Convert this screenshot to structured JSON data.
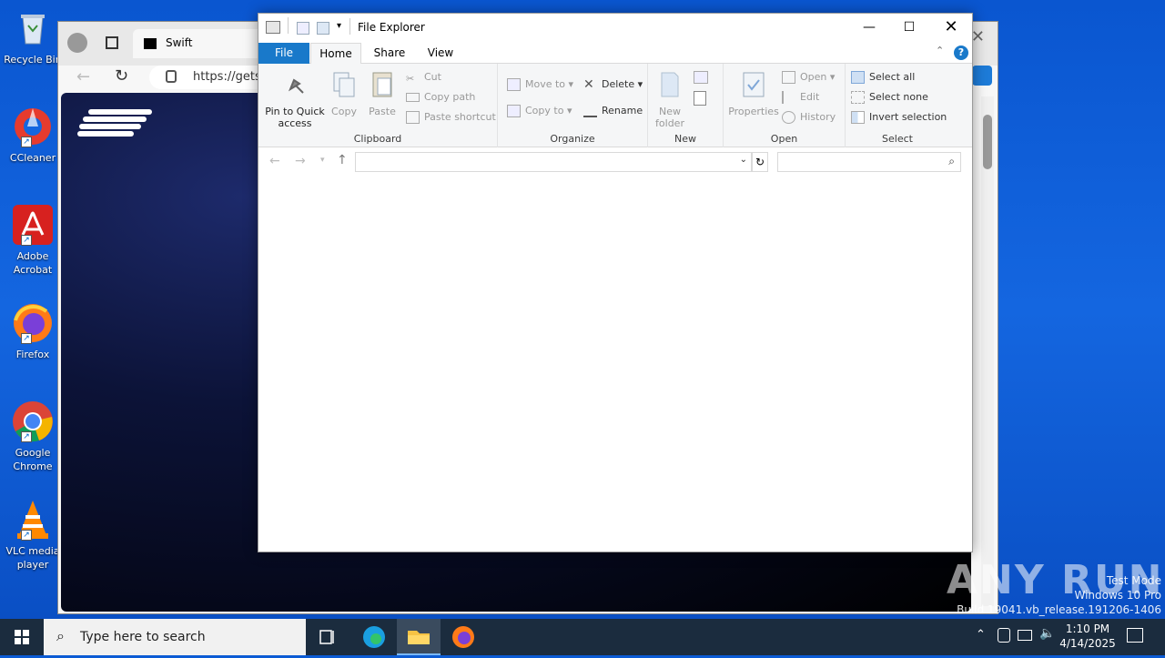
{
  "desktop": {
    "icons": [
      {
        "label": "Recycle Bin",
        "icon": "recycle-bin-icon"
      },
      {
        "label": "CCleaner",
        "icon": "ccleaner-icon"
      },
      {
        "label": "Adobe Acrobat",
        "icon": "adobe-acrobat-icon"
      },
      {
        "label": "Firefox",
        "icon": "firefox-icon"
      },
      {
        "label": "Google Chrome",
        "icon": "chrome-icon"
      },
      {
        "label": "VLC media player",
        "icon": "vlc-icon"
      }
    ]
  },
  "browser": {
    "tab_title": "Swift",
    "url": "https://gets"
  },
  "explorer": {
    "title": "File Explorer",
    "tabs": {
      "file": "File",
      "home": "Home",
      "share": "Share",
      "view": "View"
    },
    "clipboard": {
      "pin": "Pin to Quick access",
      "copy": "Copy",
      "paste": "Paste",
      "cut": "Cut",
      "copy_path": "Copy path",
      "paste_shortcut": "Paste shortcut",
      "label": "Clipboard"
    },
    "organize": {
      "move_to": "Move to",
      "copy_to": "Copy to",
      "delete": "Delete",
      "rename": "Rename",
      "label": "Organize"
    },
    "new": {
      "new_folder": "New folder",
      "label": "New"
    },
    "open": {
      "properties": "Properties",
      "open": "Open",
      "edit": "Edit",
      "history": "History",
      "label": "Open"
    },
    "select": {
      "select_all": "Select all",
      "select_none": "Select none",
      "invert": "Invert selection",
      "label": "Select"
    }
  },
  "taskbar": {
    "search_placeholder": "Type here to search",
    "time": "1:10 PM",
    "date": "4/14/2025"
  },
  "watermark": {
    "brand": "ANY RUN",
    "line1": "Test Mode",
    "line2": "Windows 10 Pro",
    "line3": "Build 19041.vb_release.191206-1406"
  },
  "colors": {
    "desktop": "#0b5bd4",
    "file_tab": "#1979ca",
    "taskbar": "#1b2c3e"
  }
}
